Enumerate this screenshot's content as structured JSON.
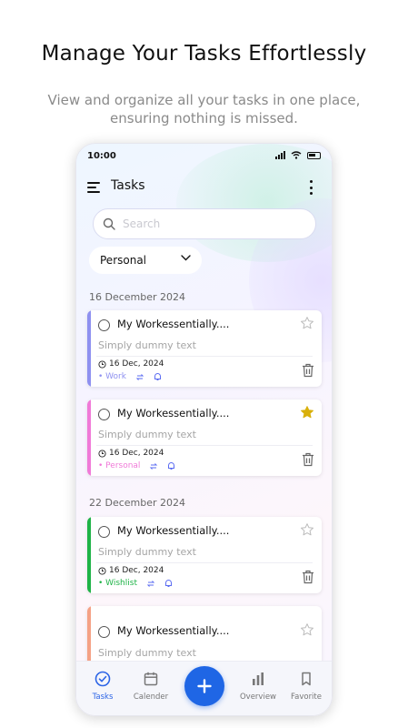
{
  "promo": {
    "headline": "Manage Your Tasks Effortlessly",
    "subline": "View and organize all your tasks in one place, ensuring nothing is missed."
  },
  "status_bar": {
    "time": "10:00"
  },
  "app_bar": {
    "title": "Tasks",
    "menu_icon": "hamburger-icon",
    "more_icon": "more-vertical-icon"
  },
  "search": {
    "placeholder": "Search",
    "value": ""
  },
  "filter": {
    "selected": "Personal"
  },
  "groups": [
    {
      "date": "16 December 2024",
      "tasks": [
        {
          "title": "My Workessentially....",
          "description": "Simply dummy text",
          "date": "16 Dec, 2024",
          "category": "• Work",
          "color": "#8e90f0",
          "starred": false
        },
        {
          "title": "My Workessentially....",
          "description": "Simply dummy text",
          "date": "16 Dec, 2024",
          "category": "• Personal",
          "color": "#f07ad8",
          "starred": true
        }
      ]
    },
    {
      "date": "22 December 2024",
      "tasks": [
        {
          "title": "My Workessentially....",
          "description": "Simply dummy text",
          "date": "16 Dec, 2024",
          "category": "• Wishlist",
          "color": "#1fb347",
          "starred": false
        },
        {
          "title": "My Workessentially....",
          "description": "Simply dummy text",
          "color": "#f5a185",
          "starred": false
        }
      ]
    }
  ],
  "bottom_nav": {
    "items": [
      {
        "label": "Tasks",
        "icon": "check-circle-icon",
        "active": true
      },
      {
        "label": "Calender",
        "icon": "calendar-icon",
        "active": false
      },
      {
        "label": "Overview",
        "icon": "bar-chart-icon",
        "active": false
      },
      {
        "label": "Favorite",
        "icon": "bookmark-icon",
        "active": false
      }
    ],
    "fab_icon": "plus-icon"
  },
  "colors": {
    "accent": "#1f66e5",
    "star": "#d9b00a"
  }
}
